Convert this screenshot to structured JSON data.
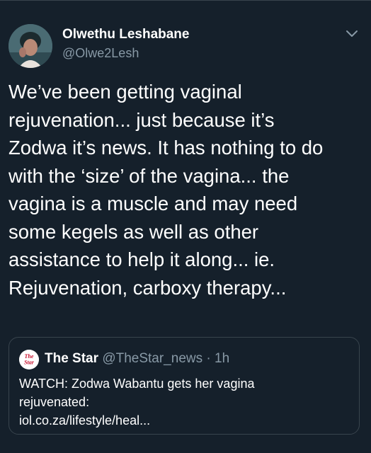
{
  "tweet": {
    "display_name": "Olwethu Leshabane",
    "handle": "@Olwe2Lesh",
    "avatar_icon": "profile-photo",
    "more_icon": "chevron-down-icon",
    "text_lines": [
      "We’ve been getting vaginal",
      "rejuvenation... just because it’s",
      "Zodwa it’s news. It has nothing to do",
      "with the ‘size’ of the vagina... the",
      "vagina is a muscle and may need",
      "some kegels as well as other",
      "assistance to help it along... ie.",
      "Rejuvenation, carboxy therapy..."
    ]
  },
  "quoted_tweet": {
    "logo_text": "The Star",
    "logo_color": "#c8102e",
    "name": "The Star",
    "handle": "@TheStar_news",
    "separator": "·",
    "time": "1h",
    "text_lines": [
      "WATCH: Zodwa Wabantu gets her vagina",
      "rejuvenated:",
      "iol.co.za/lifestyle/heal..."
    ]
  },
  "colors": {
    "background": "#15202b",
    "text_primary": "#ffffff",
    "text_secondary": "#8899a6",
    "border": "#38444d"
  }
}
